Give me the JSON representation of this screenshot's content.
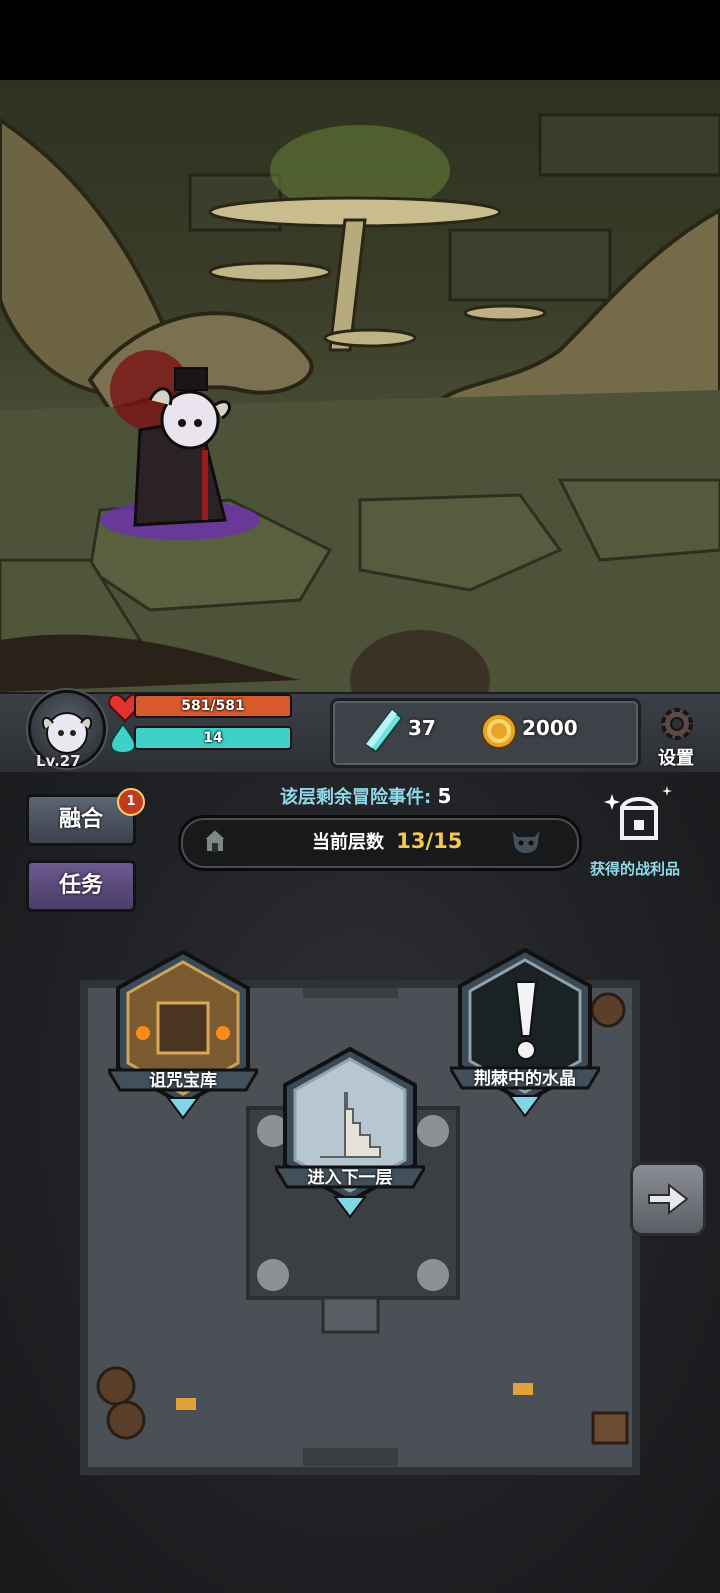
{
  "player": {
    "level_label": "Lv.27"
  },
  "hp": {
    "text": "581/581",
    "fraction": 1.0,
    "color": "#d75a2c"
  },
  "mp": {
    "text": "14",
    "fraction": 1.0,
    "color": "#3fd0c7"
  },
  "resources": {
    "crystals": "37",
    "gold": "2000"
  },
  "settings": {
    "label": "设置"
  },
  "buttons": {
    "fuse": "融合",
    "fuse_badge": "1",
    "quest": "任务"
  },
  "events": {
    "label": "该层剩余冒险事件:",
    "count": "5"
  },
  "floor": {
    "label": "当前层数",
    "value": "13/15"
  },
  "loot": {
    "label": "获得的战利品"
  },
  "nodes": {
    "vault": "诅咒宝库",
    "crystal": "荆棘中的水晶",
    "next": "进入下一层"
  },
  "colors": {
    "accent_yellow": "#f2c94c",
    "cyan": "#8fd9e8",
    "purple_button": "#5b4a7c"
  }
}
